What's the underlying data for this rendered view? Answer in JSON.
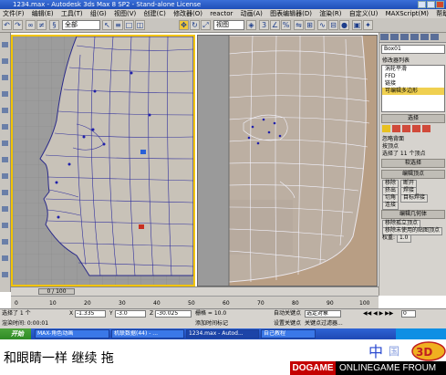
{
  "window": {
    "title": "1234.max - Autodesk 3ds Max 8 SP2 - Stand-alone License"
  },
  "menu": [
    "文件(F)",
    "编辑(E)",
    "工具(T)",
    "组(G)",
    "视图(V)",
    "创建(C)",
    "修改器(O)",
    "reactor",
    "动画(A)",
    "图表编辑器(D)",
    "渲染(R)",
    "自定义(U)",
    "MAXScript(M)",
    "帮助(H)"
  ],
  "toolbar": {
    "selection_filter": "全部",
    "ref_coord": "视图"
  },
  "command_panel": {
    "object_name": "Box01",
    "modifier_list_label": "修改器列表",
    "stack": [
      "涡轮平滑",
      "FFD",
      "链接",
      "可编辑多边形"
    ],
    "rollout_selection": "选择",
    "ignore_backfacing": "忽略背面",
    "by_vertex": "按顶点",
    "selected_count": "选择了 11 个顶点",
    "rollout_soft_sel": "软选择",
    "rollout_edit_vertices": "编辑顶点",
    "remove": "移除",
    "break": "断开",
    "extrude": "挤出",
    "weld": "焊接",
    "chamfer": "切角",
    "target_weld": "目标焊接",
    "connect": "连接",
    "rollout_edit_geometry": "编辑几何体",
    "remove_isolated": "移除孤立顶点",
    "remove_unused_map": "移除未使用的贴图顶点",
    "weight_label": "权重:",
    "weight_value": "1.0"
  },
  "timeline": {
    "frame": "0 / 100"
  },
  "ruler_ticks": [
    "0",
    "10",
    "20",
    "30",
    "40",
    "50",
    "60",
    "70",
    "80",
    "90",
    "100"
  ],
  "status": {
    "selected": "选择了 1 个",
    "x_label": "X",
    "x": "-1.335",
    "y_label": "Y",
    "y": "-3.0",
    "z_label": "Z",
    "z": "-30.025",
    "grid": "栅格 = 10.0",
    "add_time_tag": "添加时间标记",
    "auto_key": "自动关键点",
    "selected_obj": "选定对象",
    "set_key": "设置关键点",
    "key_filters": "关键点过滤器...",
    "render_time": "渲染时间: 0:00:01",
    "frame_box": "0"
  },
  "taskbar": {
    "start": "开始",
    "tasks": [
      "MAX-角色动画",
      "机联数据(44) - ...",
      "1234.max - Autod...",
      "自己教程"
    ]
  },
  "caption": "和眼睛一样 继续 拖",
  "watermark": {
    "brand_red": "DOGAME",
    "brand_text": "ONLINEGAME FROUM"
  },
  "colors": {
    "accent_yellow": "#f2c400",
    "xp_blue": "#245edb",
    "brand_red": "#c40000"
  }
}
